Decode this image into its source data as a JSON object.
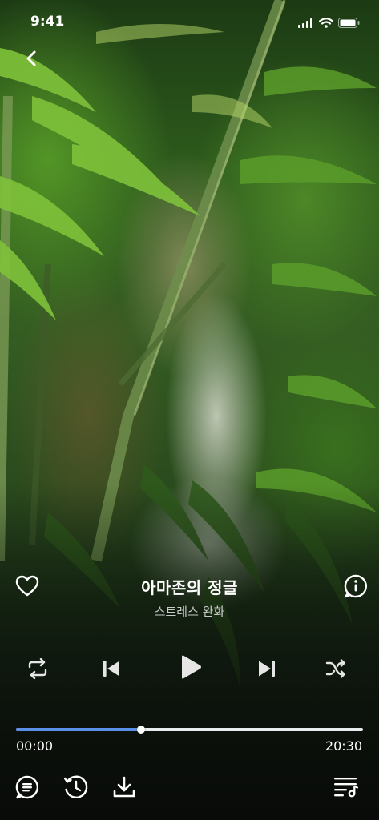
{
  "status_bar": {
    "time": "9:41"
  },
  "player": {
    "title": "아마존의 정글",
    "subtitle": "스트레스 완화",
    "elapsed": "00:00",
    "duration": "20:30",
    "progress_fraction": 0.36
  },
  "icons": {
    "back": "chevron-left-icon",
    "favorite": "heart-outline-icon",
    "info": "info-bubble-icon",
    "repeat": "repeat-icon",
    "previous": "skip-previous-icon",
    "play": "play-icon",
    "next": "skip-next-icon",
    "shuffle": "shuffle-icon",
    "lyrics": "text-bubble-icon",
    "timer": "sleep-timer-icon",
    "download": "download-icon",
    "playlist": "playlist-icon"
  },
  "colors": {
    "accent": "#5b8fe8",
    "track": "#e9ecef",
    "text_primary": "#ffffff",
    "text_secondary": "#c9cbc9"
  }
}
